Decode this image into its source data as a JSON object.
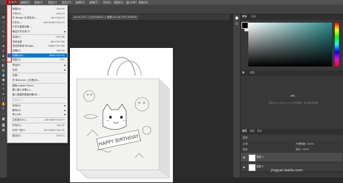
{
  "menubar": [
    "文件(F)",
    "编辑(E)",
    "图像(I)",
    "图层(L)",
    "类型(Y)",
    "选择(S)",
    "滤镜(T)",
    "3D(D)",
    "视图(V)",
    "窗口(W)",
    "帮助(H)"
  ],
  "doc_tab": "pc-01-2(5...) 从(RGB/8#) × 编辑.png @ 50% (RGB/8)",
  "file_menu": [
    {
      "label": "新建(N)...",
      "shortcut": "Ctrl+N"
    },
    {
      "label": "打开(O)...",
      "shortcut": "Ctrl+O"
    },
    {
      "label": "在 Bridge 中浏览(B)...",
      "shortcut": "Alt+Ctrl+O"
    },
    {
      "label": "打开为...",
      "shortcut": "Alt+Shift+Ctrl+O"
    },
    {
      "label": "打开为智能对象...",
      "shortcut": ""
    },
    {
      "label": "最近打开文件(T)",
      "shortcut": "",
      "submenu": true
    },
    {
      "label": "关闭(C)",
      "shortcut": "Ctrl+W"
    },
    {
      "label": "关闭全部",
      "shortcut": "Alt+Ctrl+W"
    },
    {
      "label": "关闭并转到 Bridge...",
      "shortcut": "Shift+Ctrl+W"
    },
    {
      "label": "存储(S)",
      "shortcut": "Ctrl+S"
    },
    {
      "label": "存储为(A)...",
      "shortcut": "Shift+Ctrl+S",
      "selected": true
    },
    {
      "label": "恢复(V)",
      "shortcut": "F12"
    },
    {
      "label": "导出(E)",
      "shortcut": "",
      "submenu": true
    },
    {
      "label": "生成",
      "shortcut": "",
      "submenu": true
    },
    {
      "label": "共享...",
      "shortcut": ""
    },
    {
      "label": "在 Behance 上共享(D)...",
      "shortcut": ""
    },
    {
      "label": "搜索 Adobe Stock...",
      "shortcut": ""
    },
    {
      "label": "置入嵌入对象(L)...",
      "shortcut": ""
    },
    {
      "label": "置入链接的智能对象(K)...",
      "shortcut": ""
    },
    {
      "label": "打包(G)...",
      "shortcut": "",
      "disabled": true
    },
    {
      "label": "自动(U)",
      "shortcut": "",
      "submenu": true
    },
    {
      "label": "脚本(R)",
      "shortcut": "",
      "submenu": true
    },
    {
      "label": "导入(M)",
      "shortcut": "",
      "submenu": true
    },
    {
      "label": "文件简介(F)...",
      "shortcut": "Alt+Shift+Ctrl+I"
    },
    {
      "label": "打印(P)...",
      "shortcut": "Ctrl+P"
    },
    {
      "label": "打印一份(Y)",
      "shortcut": "Alt+Shift+Ctrl+P"
    },
    {
      "label": "退出(X)",
      "shortcut": "Ctrl+Q"
    }
  ],
  "panels": {
    "color_tabs": [
      "颜色",
      "色板"
    ],
    "library_tabs": [
      "库",
      "调整"
    ],
    "library_message": "您可以在 Creative Cloud 库中查看、访问和共享资源",
    "layers_tabs": [
      "图层",
      "通道",
      "路径"
    ],
    "layers_kind": "类型",
    "layers_mode": "正常",
    "layers_opacity": "不透明度: 100%",
    "layers_lock": "锁定:",
    "layers_fill": "填充: 100%",
    "layers": [
      "图层 1",
      "图层 0"
    ]
  },
  "colors": {
    "foreground": "#000000",
    "background": "#ffffff",
    "accent": "#0078d7"
  },
  "watermark": "jingyan.baidu.com"
}
